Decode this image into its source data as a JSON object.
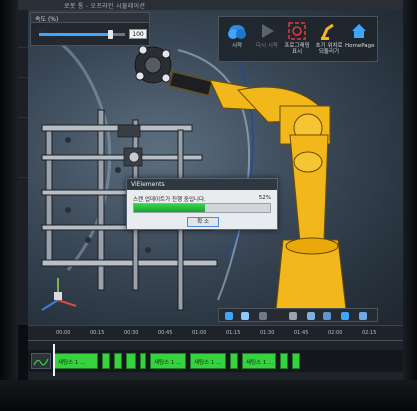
{
  "window": {
    "title": "로봇 통 - 오프라인 시뮬레이션"
  },
  "speed_panel": {
    "title": "속도 (%)",
    "value": "100",
    "level_pct": 82
  },
  "toolbar": {
    "buttons": [
      {
        "label": "시작",
        "icon": "play-icon"
      },
      {
        "label": "다시 시작",
        "icon": "restart-icon"
      },
      {
        "label": "프로그래밍\n표시",
        "icon": "program-capture-icon"
      },
      {
        "label": "초기 위치로\n되돌리기",
        "icon": "reset-position-icon"
      },
      {
        "label": "HomePage",
        "icon": "home-icon"
      }
    ]
  },
  "dialog": {
    "title": "ViElements",
    "message": "스캔 업데이트가 진행 중입니다.",
    "percent_label": "52%",
    "progress": 0.52,
    "button_label": "확 소"
  },
  "timeline": {
    "ticks": [
      "00:00",
      "00:15",
      "00:30",
      "00:45",
      "01:00",
      "01:15",
      "01:30",
      "01:45",
      "02:00",
      "02:15"
    ],
    "segments": [
      {
        "label": "세팅스 1 ..."
      },
      {
        "label": ""
      },
      {
        "label": ""
      },
      {
        "label": ""
      },
      {
        "label": ""
      },
      {
        "label": "세팅스 1 ..."
      },
      {
        "label": "세팅스 1 ..."
      },
      {
        "label": ""
      },
      {
        "label": "세팅스 1 ..."
      },
      {
        "label": ""
      },
      {
        "label": ""
      }
    ]
  },
  "colors": {
    "robot": "#f2b81b",
    "progress": "#1fb32f",
    "segment": "#37d33f",
    "accent": "#3ea6ff"
  }
}
